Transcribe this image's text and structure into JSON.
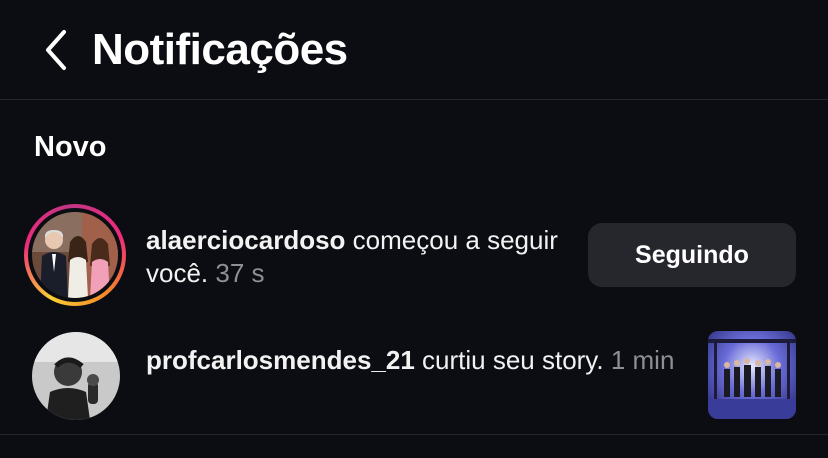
{
  "header": {
    "title": "Notificações",
    "back_icon": "chevron-left-icon"
  },
  "section": {
    "label": "Novo"
  },
  "notifications": [
    {
      "username": "alaerciocardoso",
      "action": " começou a seguir você.",
      "time": " 37 s",
      "button_label": "Seguindo",
      "has_story_ring": true
    },
    {
      "username": "profcarlosmendes_21",
      "action": " curtiu seu story.",
      "time": " 1 min",
      "has_story_ring": false
    }
  ],
  "colors": {
    "background": "#0c0d12",
    "button_bg": "#26272d",
    "muted_text": "#8e8e93",
    "ring_start": "#f9ce34",
    "ring_end": "#ee2a7b"
  }
}
